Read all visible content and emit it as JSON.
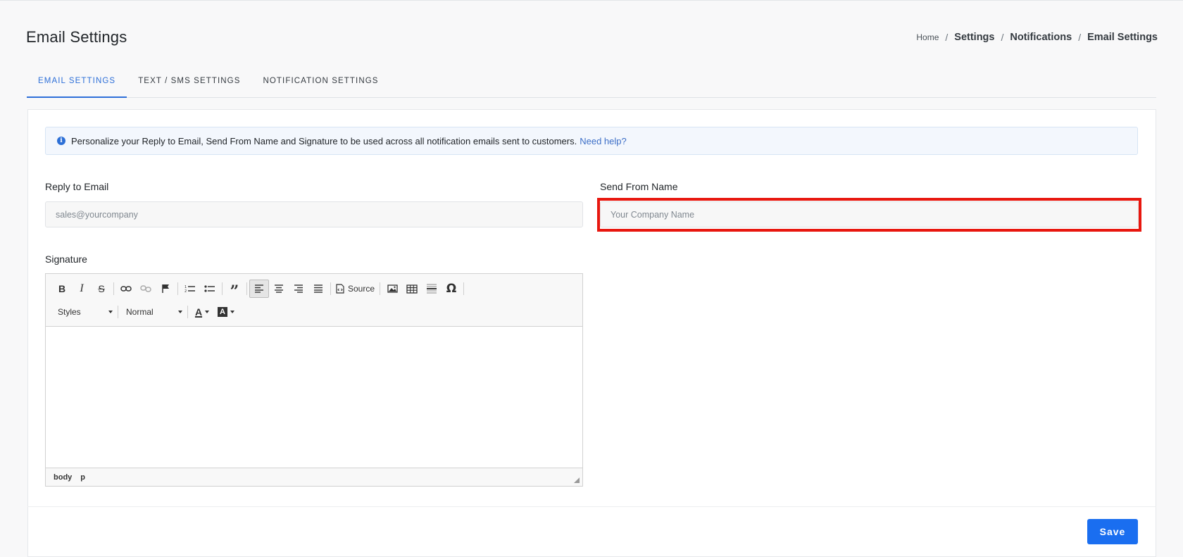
{
  "page": {
    "title": "Email Settings"
  },
  "breadcrumb": {
    "home": "Home",
    "items": [
      "Settings",
      "Notifications",
      "Email Settings"
    ],
    "separator": "/"
  },
  "tabs": [
    {
      "label": "EMAIL SETTINGS",
      "active": true
    },
    {
      "label": "TEXT / SMS SETTINGS",
      "active": false
    },
    {
      "label": "NOTIFICATION SETTINGS",
      "active": false
    }
  ],
  "alert": {
    "text": "Personalize your Reply to Email, Send From Name and Signature to be used across all notification emails sent to customers.",
    "link": "Need help?",
    "icon": "info-icon"
  },
  "form": {
    "reply_to_label": "Reply to Email",
    "reply_to_placeholder": "sales@yourcompany",
    "send_from_label": "Send From Name",
    "send_from_placeholder": "Your Company Name",
    "signature_label": "Signature"
  },
  "editor": {
    "source_label": "Source",
    "styles_label": "Styles",
    "format_label": "Normal",
    "path": [
      "body",
      "p"
    ]
  },
  "actions": {
    "save_label": "Save"
  },
  "colors": {
    "accent": "#1a6ef0",
    "highlight": "#e8170f",
    "tab_active": "#2d6fd8"
  }
}
